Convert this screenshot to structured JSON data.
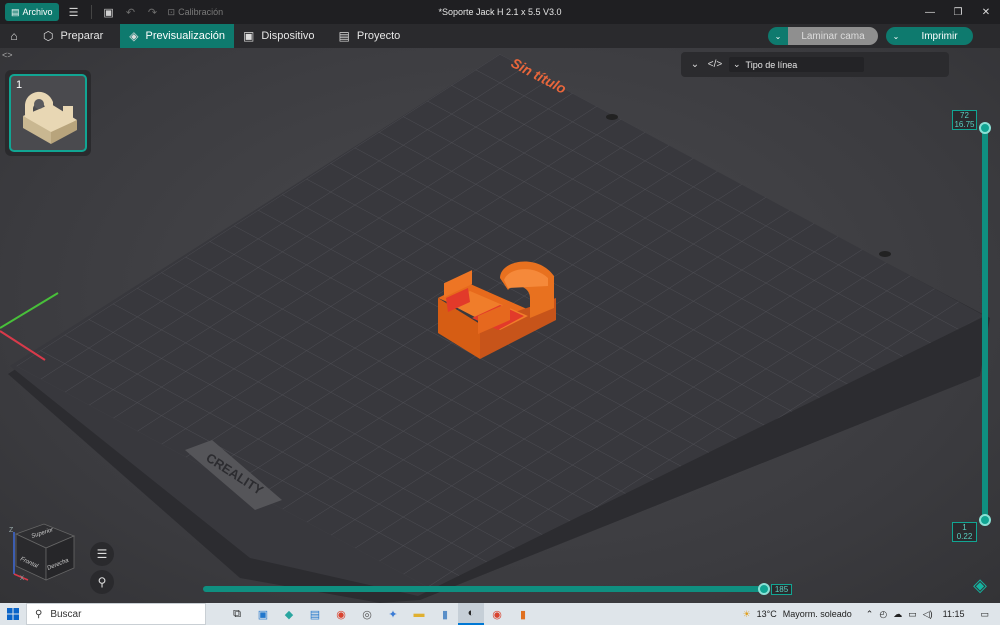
{
  "titlebar": {
    "archivo_label": "Archivo",
    "calibration_label": "Calibración",
    "window_title": "*Soporte Jack H 2.1 x 5.5  V3.0"
  },
  "tabs": [
    {
      "label": "Preparar",
      "icon": "cube-icon"
    },
    {
      "label": "Previsualización",
      "icon": "layers-icon"
    },
    {
      "label": "Dispositivo",
      "icon": "device-icon"
    },
    {
      "label": "Proyecto",
      "icon": "project-icon"
    }
  ],
  "actions": {
    "slice_label": "Laminar cama",
    "print_label": "Imprimir"
  },
  "viewport": {
    "plate_name": "Sin título",
    "brand": "CREALITY",
    "plate_number": "1",
    "line_type_label": "Tipo de línea",
    "view_cube": {
      "top": "Superior",
      "front": "Frontal",
      "right": "Derecha"
    },
    "axis_z": "Z",
    "axis_x": "X",
    "layer_slider": {
      "top_layer": "72",
      "top_height": "16.75",
      "bottom_layer": "1",
      "bottom_height": "0.22"
    },
    "move_slider_value": "185"
  },
  "taskbar": {
    "search_placeholder": "Buscar",
    "temperature": "13°C",
    "weather": "Mayorm. soleado",
    "time": "11:15"
  },
  "colors": {
    "accent": "#0e7a6e",
    "accent_light": "#11a593",
    "model": "#f07020"
  }
}
